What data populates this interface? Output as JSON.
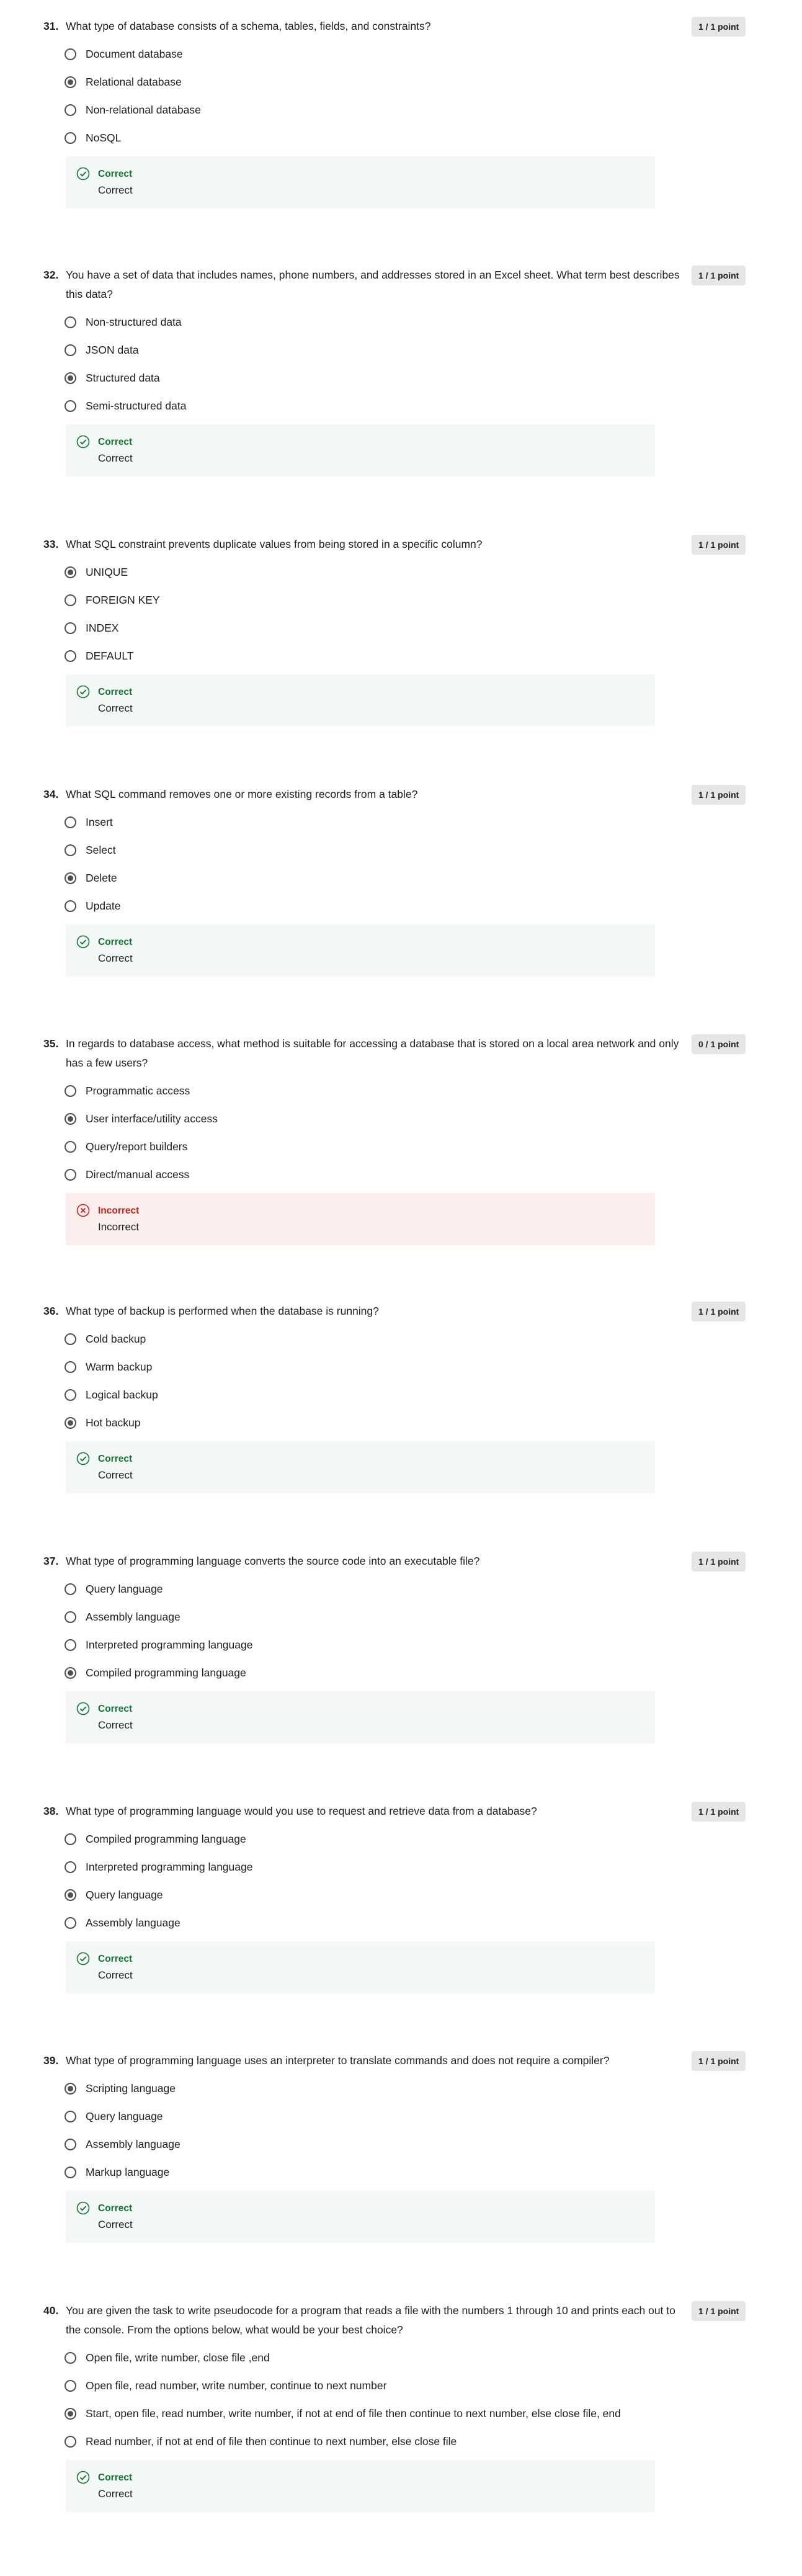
{
  "questions": [
    {
      "number": "31.",
      "text": "What type of database consists of a schema, tables, fields, and constraints?",
      "points": "1 / 1 point",
      "options": [
        "Document database",
        "Relational database",
        "Non-relational database",
        "NoSQL"
      ],
      "selected": 1,
      "result": "correct",
      "feedback_title": "Correct",
      "feedback_text": "Correct"
    },
    {
      "number": "32.",
      "text": "You have a set of data that includes names, phone numbers, and addresses stored in an Excel sheet. What term best describes this data?",
      "points": "1 / 1 point",
      "options": [
        "Non-structured data",
        "JSON data",
        "Structured data",
        "Semi-structured data"
      ],
      "selected": 2,
      "result": "correct",
      "feedback_title": "Correct",
      "feedback_text": "Correct"
    },
    {
      "number": "33.",
      "text": "What SQL constraint prevents duplicate values from being stored in a specific column?",
      "points": "1 / 1 point",
      "options": [
        "UNIQUE",
        "FOREIGN KEY",
        "INDEX",
        "DEFAULT"
      ],
      "selected": 0,
      "result": "correct",
      "feedback_title": "Correct",
      "feedback_text": "Correct"
    },
    {
      "number": "34.",
      "text": "What SQL command removes one or more existing records from a table?",
      "points": "1 / 1 point",
      "options": [
        "Insert",
        "Select",
        "Delete",
        "Update"
      ],
      "selected": 2,
      "result": "correct",
      "feedback_title": "Correct",
      "feedback_text": "Correct"
    },
    {
      "number": "35.",
      "text": "In regards to database access, what method is suitable for accessing a database that is stored on a local area network and only has a few users?",
      "points": "0 / 1 point",
      "options": [
        "Programmatic access",
        "User interface/utility access",
        "Query/report builders",
        "Direct/manual access"
      ],
      "selected": 1,
      "result": "incorrect",
      "feedback_title": "Incorrect",
      "feedback_text": "Incorrect"
    },
    {
      "number": "36.",
      "text": "What type of backup is performed when the database is running?",
      "points": "1 / 1 point",
      "options": [
        "Cold backup",
        "Warm backup",
        "Logical backup",
        "Hot backup"
      ],
      "selected": 3,
      "result": "correct",
      "feedback_title": "Correct",
      "feedback_text": "Correct"
    },
    {
      "number": "37.",
      "text": "What type of programming language converts the source code into an executable file?",
      "points": "1 / 1 point",
      "options": [
        "Query language",
        "Assembly language",
        "Interpreted programming language",
        "Compiled programming language"
      ],
      "selected": 3,
      "result": "correct",
      "feedback_title": "Correct",
      "feedback_text": "Correct"
    },
    {
      "number": "38.",
      "text": "What type of programming language would you use to request and retrieve data from a database?",
      "points": "1 / 1 point",
      "options": [
        "Compiled programming language",
        "Interpreted programming language",
        "Query language",
        "Assembly language"
      ],
      "selected": 2,
      "result": "correct",
      "feedback_title": "Correct",
      "feedback_text": "Correct"
    },
    {
      "number": "39.",
      "text": "What type of programming language uses an interpreter to translate commands and does not require a compiler?",
      "points": "1 / 1 point",
      "options": [
        "Scripting language",
        "Query language",
        "Assembly language",
        "Markup language"
      ],
      "selected": 0,
      "result": "correct",
      "feedback_title": "Correct",
      "feedback_text": "Correct"
    },
    {
      "number": "40.",
      "text": "You are given the task to write pseudocode for a program that reads a file with the numbers 1 through 10 and prints each out to the console. From the options below, what would be your best choice?",
      "points": "1 / 1 point",
      "options": [
        "Open file, write number, close file ,end",
        "Open file, read number, write number, continue to next number",
        "Start, open file, read number, write number, if not at end of file then continue to next number, else close file, end",
        "Read number, if not at end of file then continue to next number, else close file"
      ],
      "selected": 2,
      "result": "correct",
      "feedback_title": "Correct",
      "feedback_text": "Correct"
    }
  ]
}
